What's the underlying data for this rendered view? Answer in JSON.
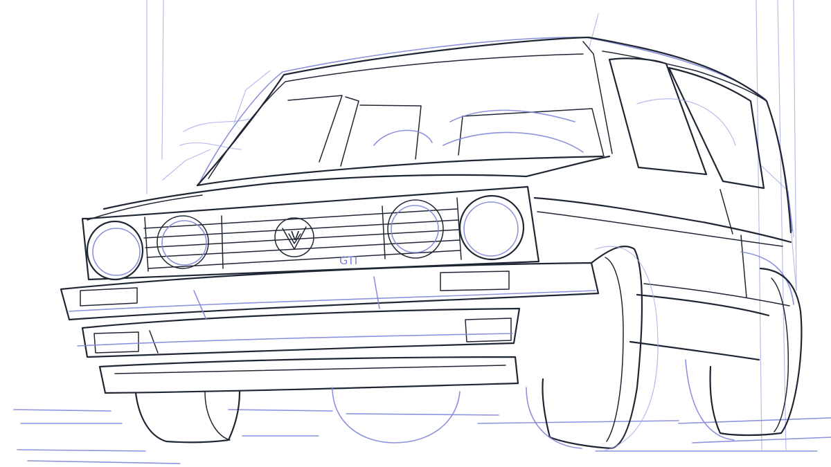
{
  "image": {
    "subject": "car-sketch",
    "colors": {
      "background": "#ffffff",
      "construction_lines": "#7f86d8",
      "ink_lines": "#1f2633"
    }
  },
  "markings": {
    "grille_badge": "V",
    "grille_text": "GTI"
  }
}
